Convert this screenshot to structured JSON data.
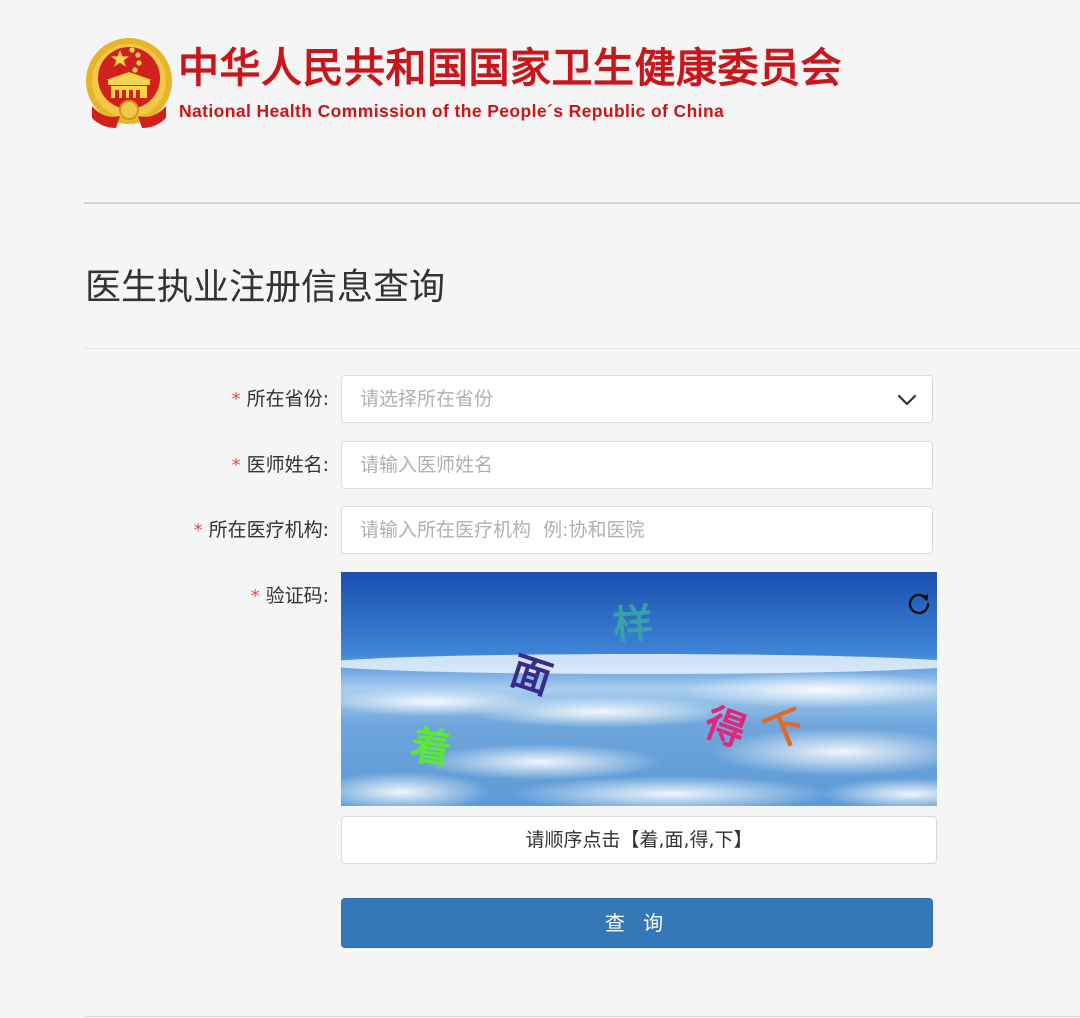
{
  "header": {
    "title": "中华人民共和国国家卫生健康委员会",
    "subtitle": "National Health Commission of the People´s Republic of China",
    "emblem_icon": "national-emblem-icon",
    "brand_color": "#c8161d"
  },
  "page": {
    "title": "医生执业注册信息查询"
  },
  "form": {
    "required_mark": "*",
    "province": {
      "label": "所在省份:",
      "placeholder": "请选择所在省份",
      "icon": "chevron-down-icon"
    },
    "doctor_name": {
      "label": "医师姓名:",
      "placeholder": "请输入医师姓名",
      "value": ""
    },
    "institution": {
      "label": "所在医疗机构:",
      "placeholder": "请输入所在医疗机构  例:协和医院",
      "value": ""
    },
    "captcha": {
      "label": "验证码:",
      "characters": [
        {
          "char": "样",
          "color": "#3aa0a8"
        },
        {
          "char": "面",
          "color": "#3a2a8a"
        },
        {
          "char": "着",
          "color": "#5ee63a"
        },
        {
          "char": "得",
          "color": "#e0287a"
        },
        {
          "char": "下",
          "color": "#e06a2a"
        }
      ],
      "refresh_icon": "refresh-icon",
      "hint": "请顺序点击【着,面,得,下】"
    },
    "submit_label": "查 询",
    "accent_color": "#3478b7"
  }
}
